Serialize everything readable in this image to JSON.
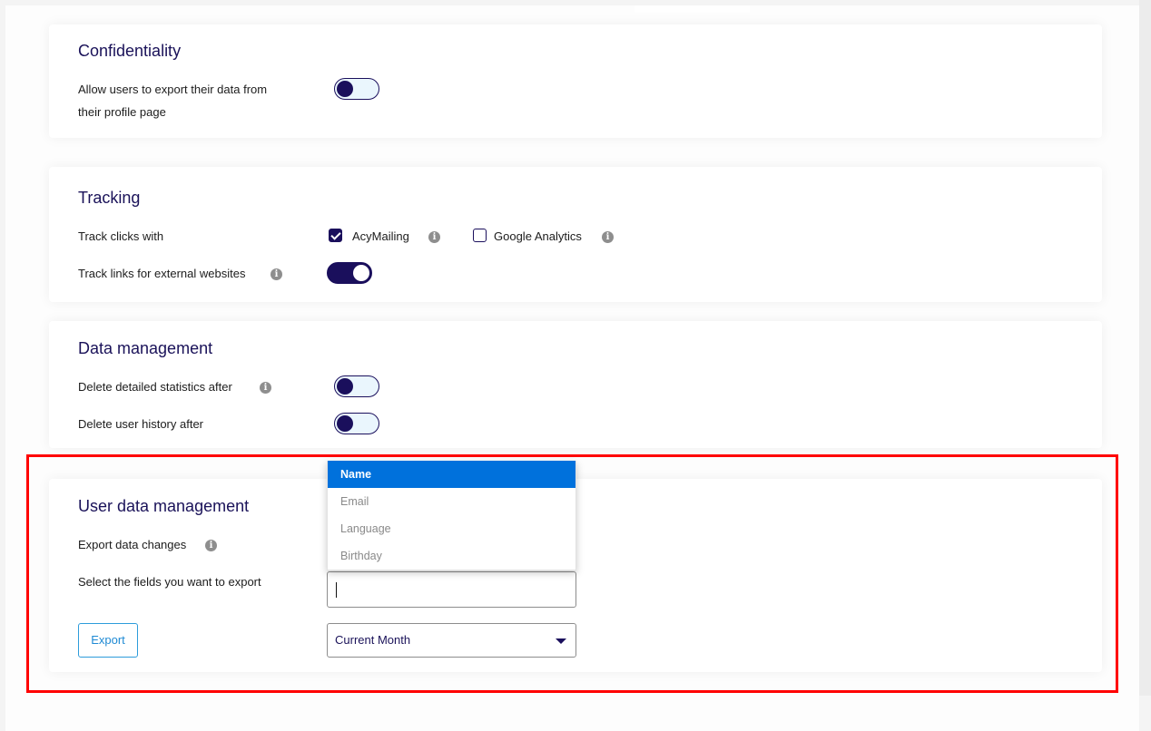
{
  "colors": {
    "accent": "#1a0f5c",
    "highlight_border": "#ff0000",
    "dropdown_active": "#0071dc",
    "link_blue": "#1f8ad4"
  },
  "confidentiality": {
    "title": "Confidentiality",
    "export_data": {
      "label_line1": "Allow users to export their data from",
      "label_line2": "their profile page",
      "enabled": false
    }
  },
  "tracking": {
    "title": "Tracking",
    "track_clicks": {
      "label": "Track clicks with",
      "options": [
        {
          "label": "AcyMailing",
          "checked": true,
          "info_icon": "info-icon"
        },
        {
          "label": "Google Analytics",
          "checked": false,
          "info_icon": "info-icon"
        }
      ]
    },
    "track_external_links": {
      "label": "Track links for external websites",
      "info_icon": "info-icon",
      "enabled": true
    }
  },
  "data_management": {
    "title": "Data management",
    "delete_statistics": {
      "label": "Delete detailed statistics after",
      "info_icon": "info-icon",
      "enabled": false
    },
    "delete_history": {
      "label": "Delete user history after",
      "enabled": false
    }
  },
  "user_data_management": {
    "title": "User data management",
    "export_changes_label": "Export data changes",
    "export_changes_info_icon": "info-icon",
    "select_fields_label": "Select the fields you want to export",
    "fields_input_value": "",
    "fields_dropdown": {
      "options": [
        "Name",
        "Email",
        "Language",
        "Birthday"
      ],
      "highlighted": "Name"
    },
    "export_button": "Export",
    "period_select": {
      "selected": "Current Month",
      "icon": "caret-down-icon"
    }
  },
  "info_glyph": "i"
}
